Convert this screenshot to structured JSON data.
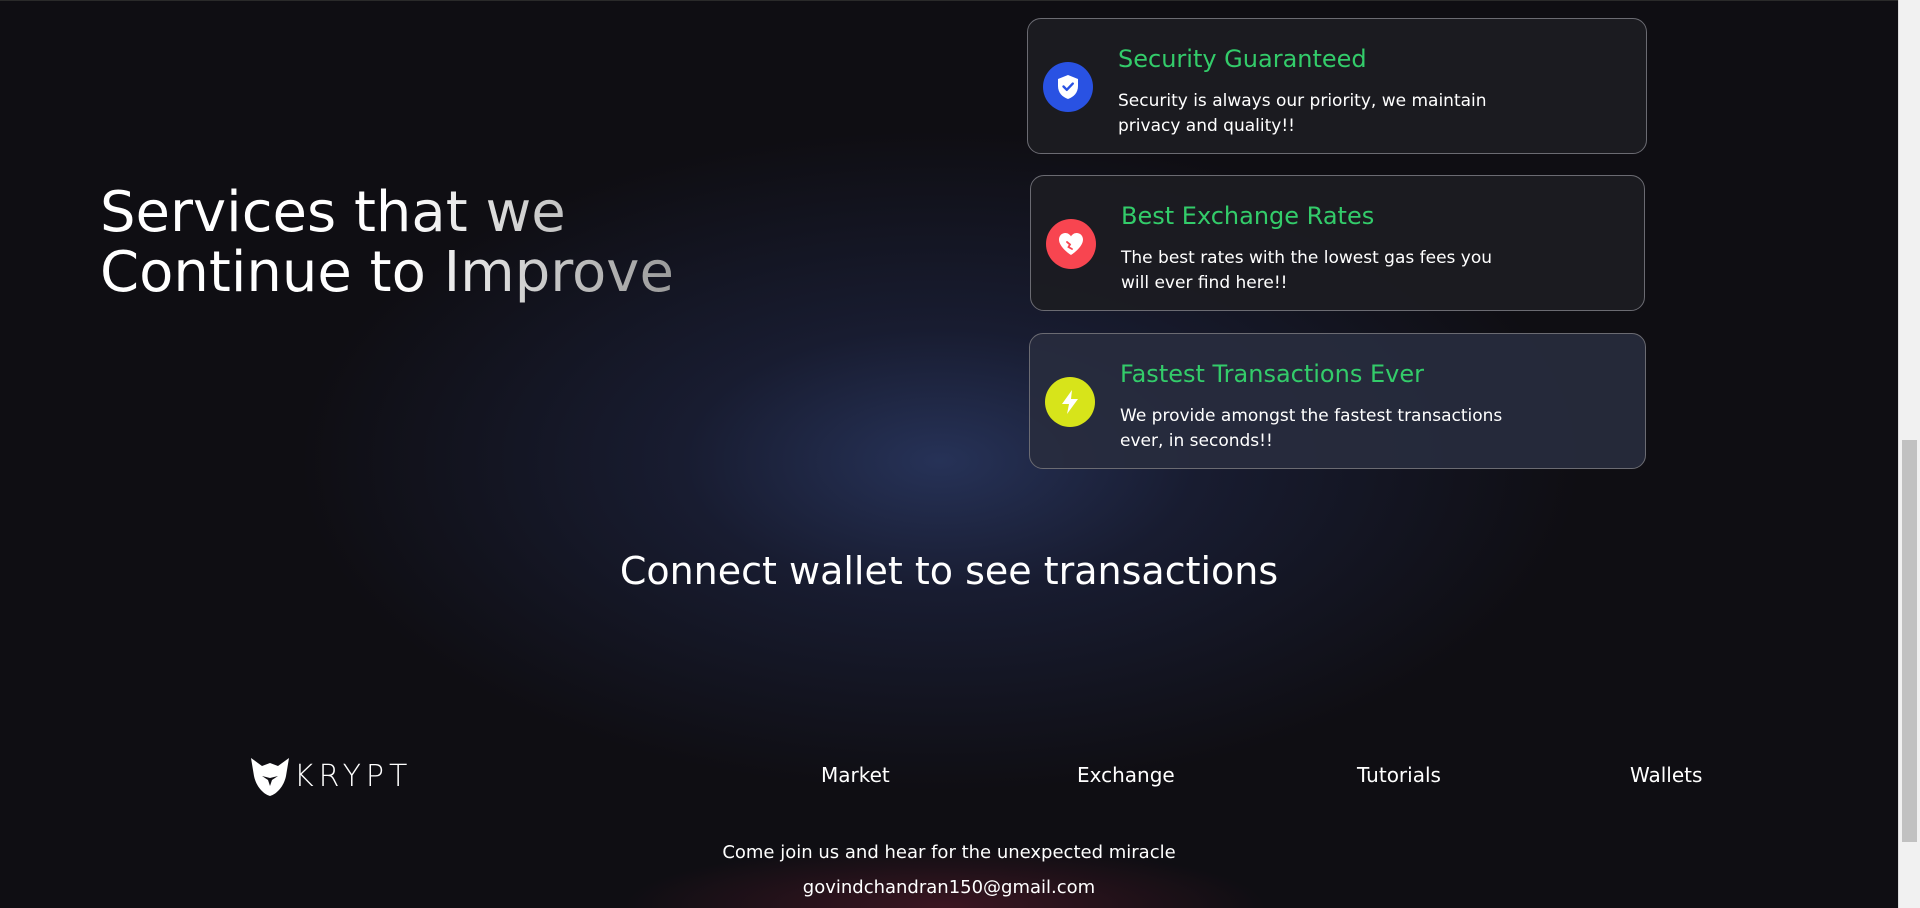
{
  "hero": {
    "title_line1": "Services that we",
    "title_line2": "Continue to Improve"
  },
  "services": [
    {
      "title": "Security Guaranteed",
      "description": "Security is always our priority, we maintain privacy and quality!!",
      "icon": "shield-check-icon",
      "icon_color": "#2952e3"
    },
    {
      "title": "Best Exchange Rates",
      "description": "The best rates with the lowest gas fees you will ever find here!!",
      "icon": "heart-icon",
      "icon_color": "#f84550"
    },
    {
      "title": "Fastest Transactions Ever",
      "description": "We provide amongst the fastest transactions ever, in seconds!!",
      "icon": "lightning-icon",
      "icon_color": "#d7e41a"
    }
  ],
  "transactions": {
    "message": "Connect wallet to see transactions"
  },
  "footer": {
    "logo_text": "KRYPT",
    "nav": [
      "Market",
      "Exchange",
      "Tutorials",
      "Wallets"
    ],
    "tagline": "Come join us and hear for the unexpected miracle",
    "email": "govindchandran150@gmail.com"
  },
  "colors": {
    "background": "#0f0e13",
    "accent_green": "#33cc6a"
  }
}
